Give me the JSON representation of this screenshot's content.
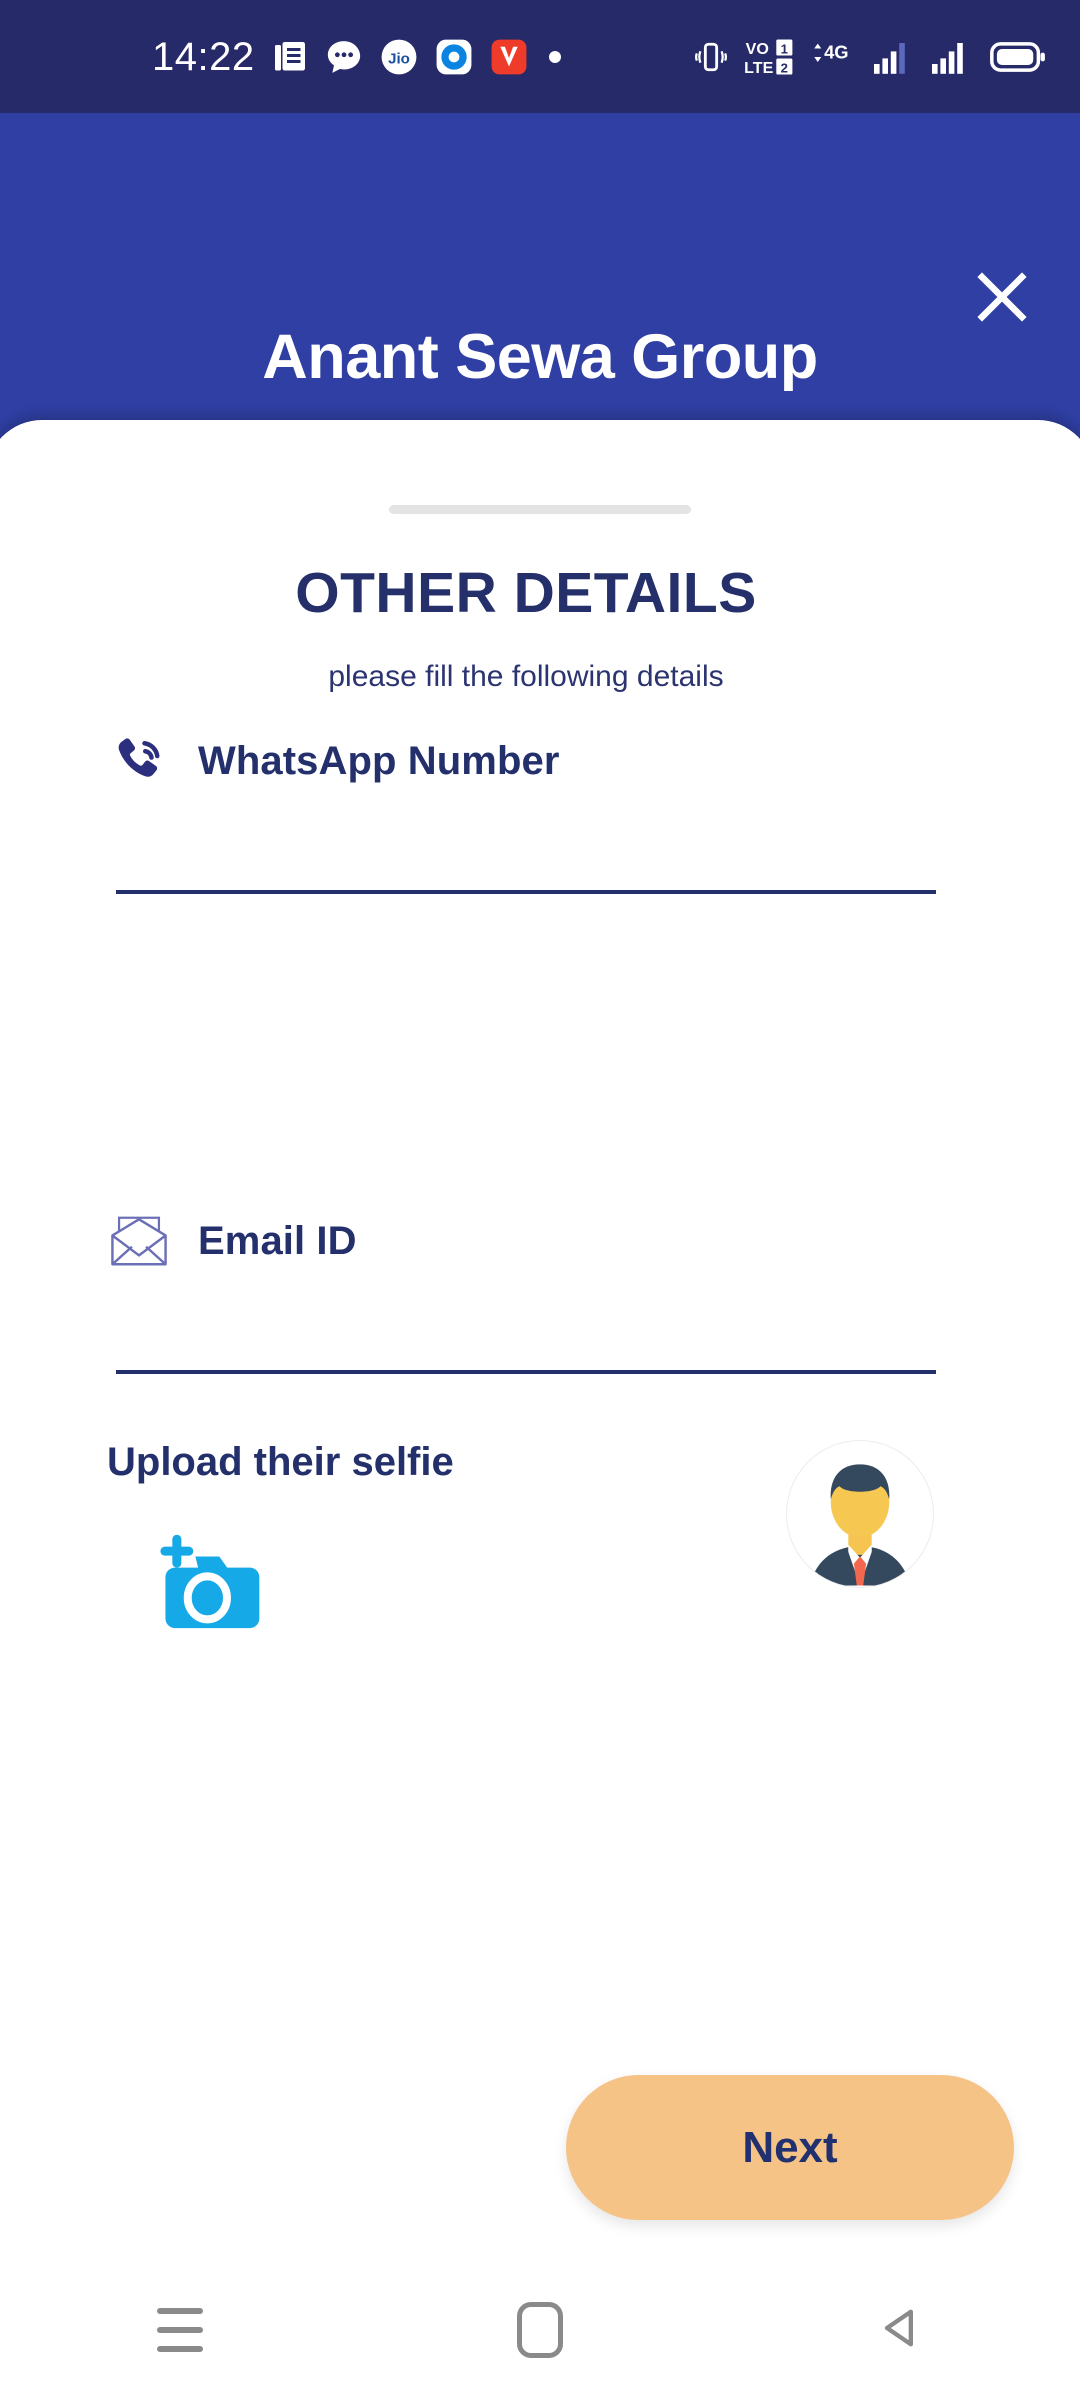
{
  "status_bar": {
    "clock": "14:22",
    "left_icons": [
      "news-icon",
      "chat-bubble-icon",
      "jio-icon",
      "app-blue-dot-icon",
      "vidmate-icon",
      "dot-icon"
    ],
    "jio_label": "Jio",
    "vidmate_label": "V",
    "right_icons": [
      "vibrate-icon",
      "volte-icon",
      "4g-icon",
      "signal-bars-1-icon",
      "signal-bars-2-icon",
      "battery-icon"
    ],
    "volte_line1": "VO",
    "volte_line2": "LTE",
    "volte_sim1": "1",
    "volte_sim2": "2",
    "network_label": "4G",
    "background": "#272a69"
  },
  "header": {
    "title": "Anant Sewa Group",
    "close_label": "✕",
    "background": "#2f3fa3",
    "title_color": "#ffffff"
  },
  "sheet": {
    "section_title": "OTHER DETAILS",
    "section_subtitle": "please fill the following details",
    "title_color": "#25306b",
    "background": "#ffffff"
  },
  "fields": [
    {
      "id": "whatsapp",
      "label": "WhatsApp Number",
      "icon": "phone-ringing-icon",
      "value": "",
      "placeholder": ""
    },
    {
      "id": "email",
      "label": "Email ID",
      "icon": "envelope-at-icon",
      "value": "",
      "placeholder": ""
    }
  ],
  "selfie": {
    "label": "Upload their selfie",
    "camera_icon": "camera-plus-icon",
    "camera_color": "#16a9e8",
    "avatar_icon": "user-avatar-icon"
  },
  "next_button": {
    "label": "Next",
    "background": "#f6c387",
    "text_color": "#21306e"
  },
  "nav_bar": {
    "recents_icon": "hamburger-recents-icon",
    "home_icon": "home-square-icon",
    "back_icon": "back-triangle-icon",
    "color": "#8a8a8a"
  }
}
